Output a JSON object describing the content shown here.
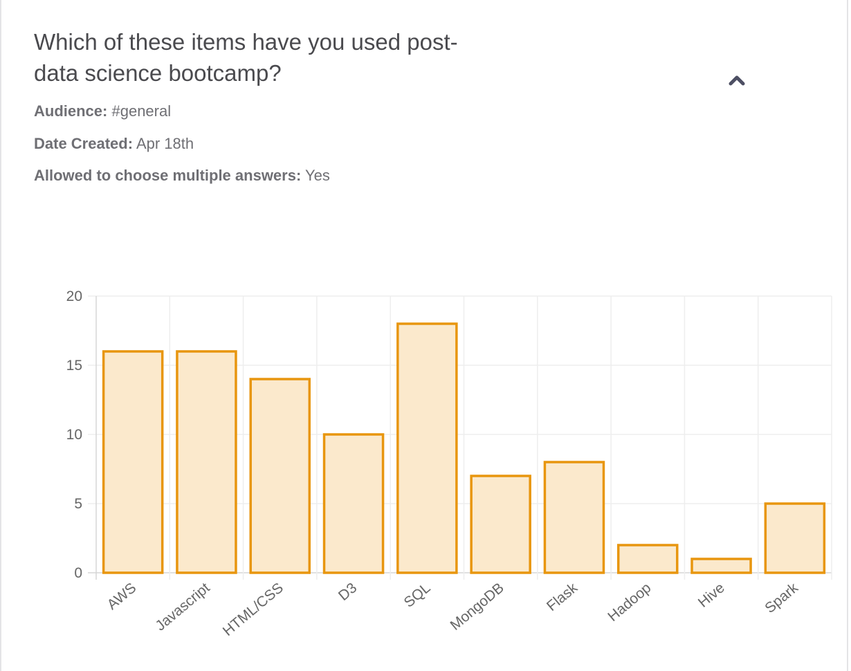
{
  "poll": {
    "question": "Which of these items have you used post-data science bootcamp?",
    "audience_label": "Audience:",
    "audience_value": "#general",
    "date_label": "Date Created:",
    "date_value": "Apr 18th",
    "multi_label": "Allowed to choose multiple answers:",
    "multi_value": "Yes",
    "collapse_icon": "chevron-up-icon"
  },
  "colors": {
    "bar_fill": "#fbe9cc",
    "bar_stroke": "#e8960f",
    "grid": "#eeeeee",
    "axis": "#d6d6d6",
    "chevron": "#4d4f63"
  },
  "chart_data": {
    "type": "bar",
    "categories": [
      "AWS",
      "Javascript",
      "HTML/CSS",
      "D3",
      "SQL",
      "MongoDB",
      "Flask",
      "Hadoop",
      "Hive",
      "Spark"
    ],
    "values": [
      16,
      16,
      14,
      10,
      18,
      7,
      8,
      2,
      1,
      5
    ],
    "title": "",
    "xlabel": "",
    "ylabel": "",
    "ylim": [
      0,
      20
    ],
    "yticks": [
      0,
      5,
      10,
      15,
      20
    ],
    "grid": true,
    "legend": "none"
  }
}
